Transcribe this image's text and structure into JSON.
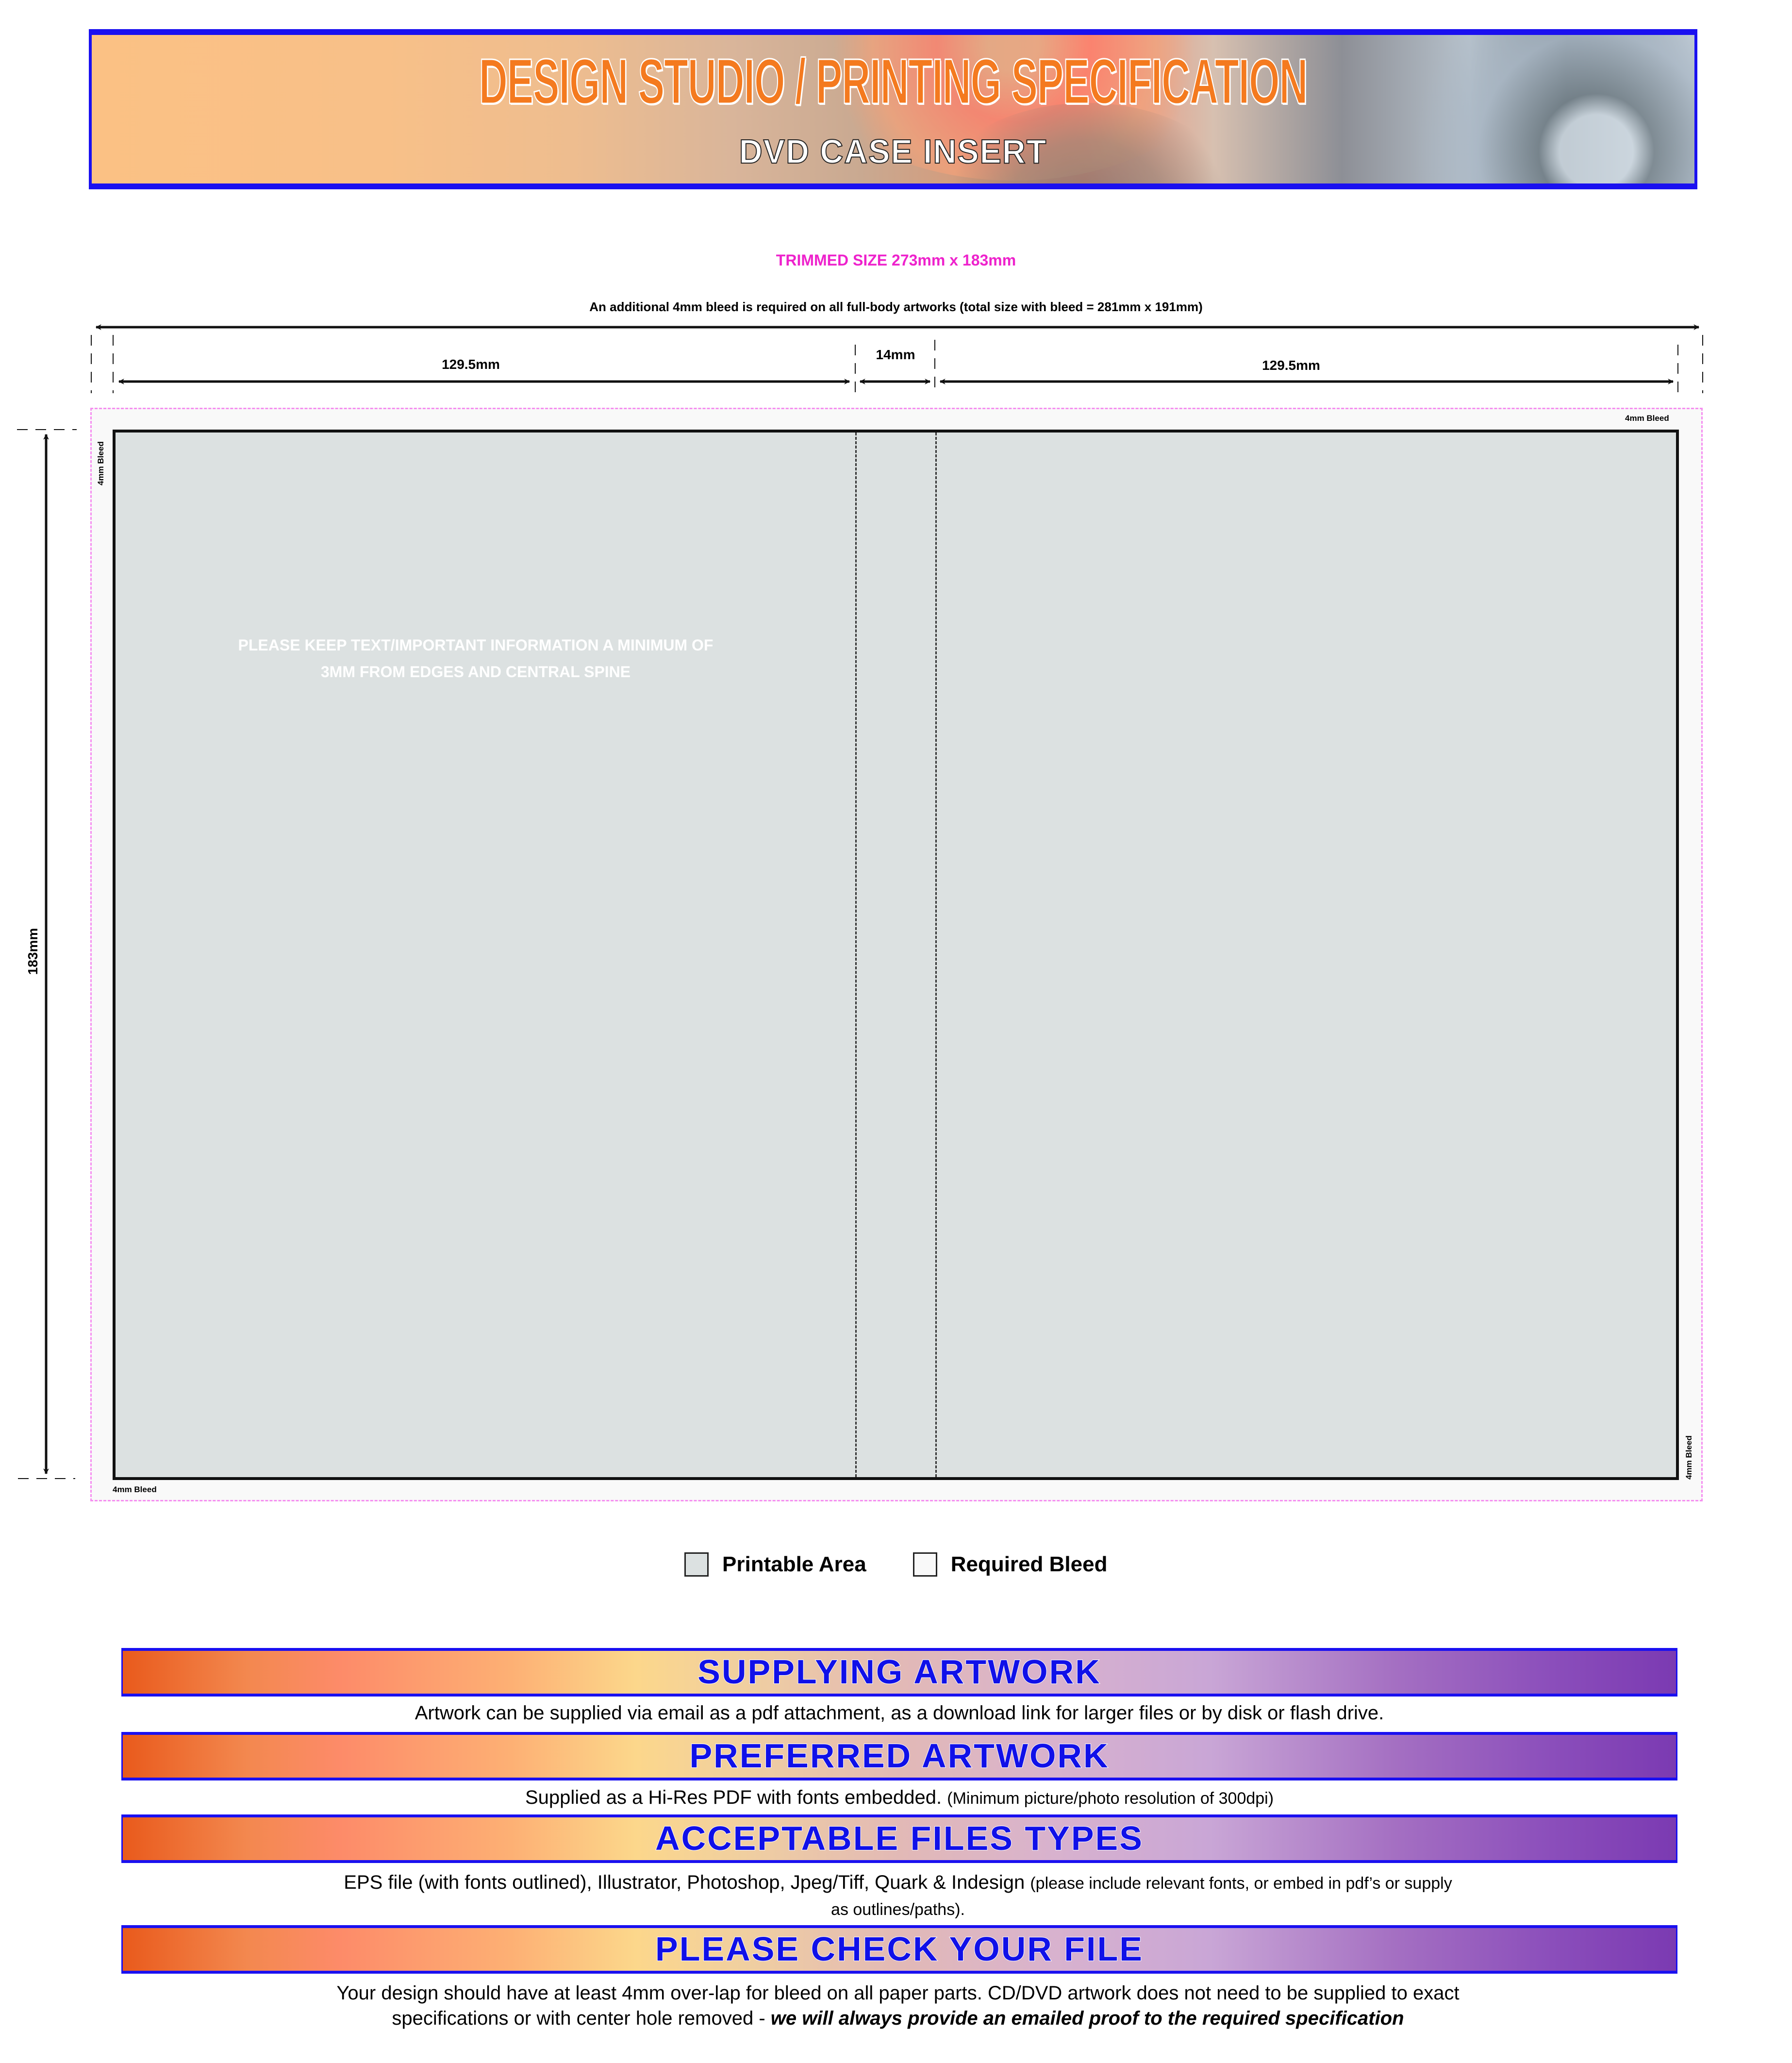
{
  "header": {
    "title": "DESIGN STUDIO / PRINTING SPECIFICATION",
    "subtitle": "DVD CASE INSERT",
    "banner_image": "cd-dvd-discs-photo"
  },
  "specs": {
    "trimmed_size": "TRIMMED SIZE 273mm x 183mm",
    "bleed_note": "An additional 4mm bleed is required on all full-body artworks (total size with bleed = 281mm x 191mm)"
  },
  "dimensions": {
    "left_panel": "129.5mm",
    "spine": "14mm",
    "right_panel": "129.5mm",
    "height": "183mm"
  },
  "template": {
    "bleed_labels": [
      "4mm Bleed",
      "4mm Bleed",
      "4mm Bleed",
      "4mm Bleed"
    ],
    "safe_zone_note_line1": "PLEASE KEEP TEXT/IMPORTANT INFORMATION A MINIMUM OF",
    "safe_zone_note_line2": "3MM FROM EDGES AND CENTRAL SPINE"
  },
  "legend": {
    "items": [
      {
        "label": "Printable Area",
        "color": "#dce1e1"
      },
      {
        "label": "Required Bleed",
        "color": "#f9f9f9"
      }
    ]
  },
  "colors": {
    "accent_blue": "#1a10f0",
    "trim_pink": "#ee22cc",
    "title_orange": "#f47a1f"
  },
  "sections": [
    {
      "title": "SUPPLYING ARTWORK",
      "body": "Artwork can be supplied via email as a pdf attachment, as a download link for larger files or by disk or flash drive."
    },
    {
      "title": "PREFERRED ARTWORK",
      "body": "Supplied as a Hi-Res PDF with fonts embedded.",
      "body_small": "(Minimum picture/photo resolution of 300dpi)"
    },
    {
      "title": "ACCEPTABLE FILES TYPES",
      "body": "EPS file (with fonts outlined), Illustrator, Photoshop, Jpeg/Tiff, Quark & Indesign",
      "body_small": "(please include relevant fonts, or embed in pdf’s or supply as outlines/paths)."
    },
    {
      "title": "PLEASE CHECK YOUR FILE",
      "body": "Your design should have at least 4mm over-lap for bleed on all paper parts. CD/DVD artwork does not need to be supplied to exact specifications or with center hole removed -",
      "body_emphasis": "we will always provide an emailed proof to the required specification"
    }
  ]
}
